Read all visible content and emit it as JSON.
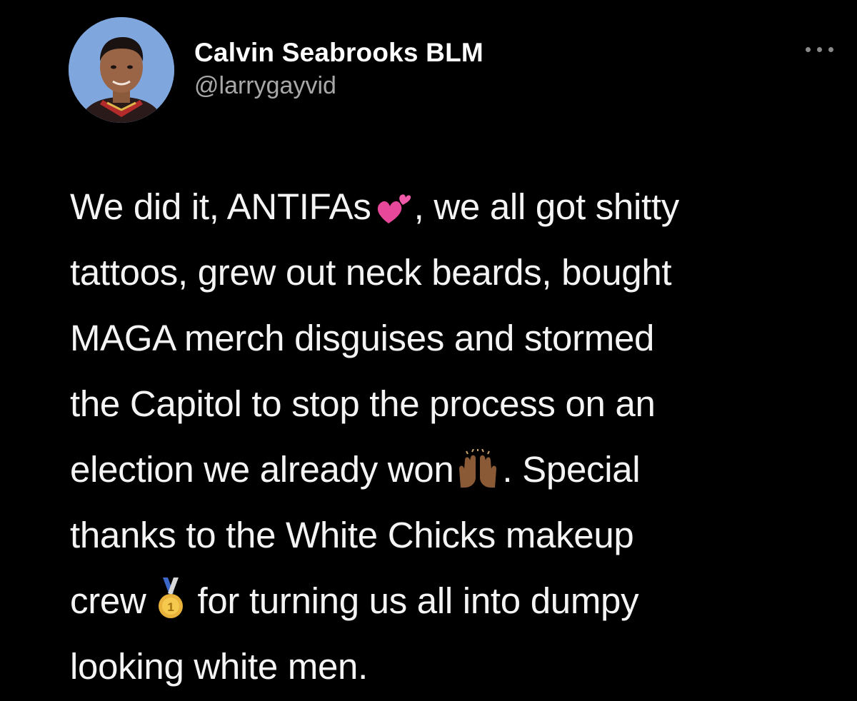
{
  "tweet": {
    "author": {
      "display_name": "Calvin Seabrooks BLM",
      "handle": "@larrygayvid"
    },
    "more_icon": "more-horizontal-icon",
    "lines": [
      {
        "before": "We did it, ANTIFAs",
        "emoji": "two-hearts-emoji",
        "after": ", we all got shitty"
      },
      {
        "text": "tattoos, grew out neck beards, bought"
      },
      {
        "text": "MAGA merch disguises and stormed"
      },
      {
        "text": "the Capitol to stop the process on an"
      },
      {
        "before": "election we already won",
        "emoji": "raising-hands-emoji",
        "after": ". Special"
      },
      {
        "text": "thanks to the White Chicks makeup"
      },
      {
        "before": "crew",
        "emoji": "first-place-medal-emoji",
        "after": "for turning us all into dumpy"
      },
      {
        "text": "looking white men."
      }
    ],
    "colors": {
      "background": "#000000",
      "text": "#f4f4f4",
      "handle": "#a8a8a8",
      "avatar_bg": "#7fa7de"
    }
  }
}
